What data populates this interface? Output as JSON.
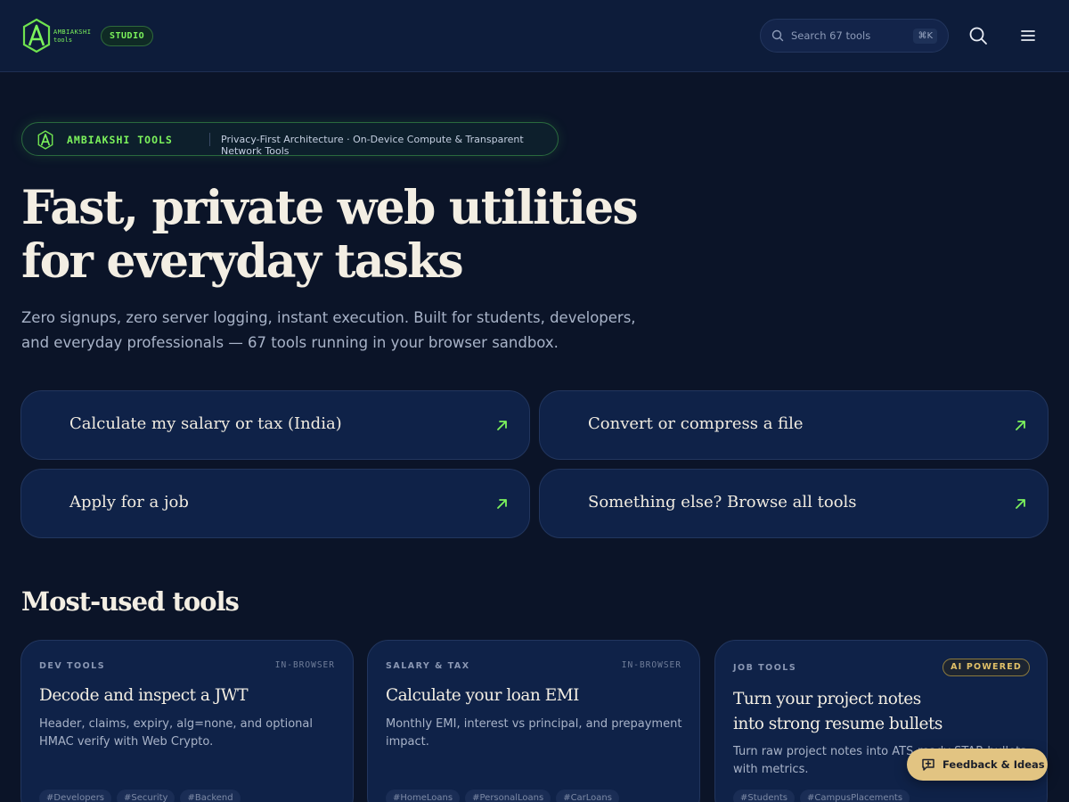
{
  "header": {
    "logo_line1": "AMBIAKSHI",
    "logo_line2": "tools",
    "studio_badge": "STUDIO",
    "search_placeholder": "Search 67 tools",
    "search_shortcut": "⌘K",
    "search_icon": "search-icon",
    "menu_icon": "hamburger-menu-icon"
  },
  "hero": {
    "pill_brand": "AMBIAKSHI TOOLS",
    "pill_tagline": "Privacy-First Architecture · On-Device Compute & Transparent Network Tools",
    "title_line1": "Fast, private web utilities",
    "title_line2": "for everyday tasks",
    "subtitle_line1": "Zero signups, zero server logging, instant execution. Built for students, developers,",
    "subtitle_line2": "and everyday professionals — 67 tools running in your browser sandbox."
  },
  "quick_actions": [
    {
      "label": "Calculate my salary or tax (India)"
    },
    {
      "label": "Convert or compress a file"
    },
    {
      "label": "Apply for a job"
    },
    {
      "label": "Something else? Browse all tools"
    }
  ],
  "most_used": {
    "title": "Most-used tools",
    "cards": [
      {
        "category": "DEV TOOLS",
        "mode": "IN-BROWSER",
        "name": "Decode and inspect a JWT",
        "description": "Header, claims, expiry, alg=none, and optional HMAC verify with Web Crypto.",
        "tags": [
          "#Developers",
          "#Security",
          "#Backend"
        ]
      },
      {
        "category": "SALARY & TAX",
        "mode": "IN-BROWSER",
        "name": "Calculate your loan EMI",
        "description": "Monthly EMI, interest vs principal, and prepayment impact.",
        "tags": [
          "#HomeLoans",
          "#PersonalLoans",
          "#CarLoans"
        ]
      },
      {
        "category": "JOB TOOLS",
        "mode": "AI POWERED",
        "name_line1": "Turn your project notes",
        "name_line2": "into strong resume bullets",
        "description": "Turn raw project notes into ATS-ready STAR bullets with metrics.",
        "tags": [
          "#Students",
          "#CampusPlacements"
        ]
      }
    ]
  },
  "feedback": {
    "label": "Feedback & Ideas"
  },
  "colors": {
    "background": "#0b1428",
    "header": "#0d1c3a",
    "accent_green": "#7cf35c",
    "card": "#0f2248",
    "feedback": "#e2c482",
    "ai_badge": "#e1c068"
  }
}
